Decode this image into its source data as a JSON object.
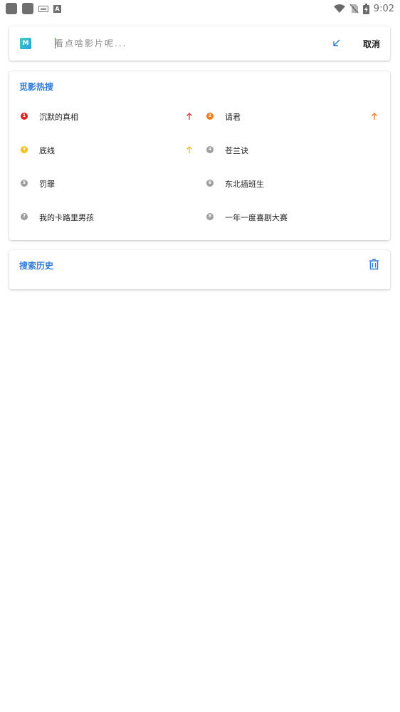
{
  "status_bar": {
    "time": "9:02",
    "left_icons": [
      "app-icon-1",
      "app-icon-2",
      "keyboard-icon",
      "font-a-icon"
    ],
    "right_icons": [
      "wifi-icon",
      "no-sim-icon",
      "battery-charging-icon"
    ]
  },
  "search": {
    "placeholder": "看点啥影片呢...",
    "value": "",
    "cancel_label": "取消",
    "logo_text": "M",
    "accent": "#2e7bd6"
  },
  "hot": {
    "title": "觅影热搜",
    "items": [
      {
        "rank": "1",
        "name": "沉默的真相",
        "trend": "up",
        "badge_color": "#e02424",
        "trend_color": "#d73a3a"
      },
      {
        "rank": "2",
        "name": "请君",
        "trend": "up",
        "badge_color": "#f07a1a",
        "trend_color": "#f07a1a"
      },
      {
        "rank": "3",
        "name": "底线",
        "trend": "up",
        "badge_color": "#f2c11b",
        "trend_color": "#f2b81b"
      },
      {
        "rank": "4",
        "name": "苍兰诀",
        "trend": "",
        "badge_color": "#9e9e9e",
        "trend_color": ""
      },
      {
        "rank": "5",
        "name": "罚罪",
        "trend": "",
        "badge_color": "#9e9e9e",
        "trend_color": ""
      },
      {
        "rank": "6",
        "name": "东北插班生",
        "trend": "",
        "badge_color": "#9e9e9e",
        "trend_color": ""
      },
      {
        "rank": "7",
        "name": "我的卡路里男孩",
        "trend": "",
        "badge_color": "#9e9e9e",
        "trend_color": ""
      },
      {
        "rank": "8",
        "name": "一年一度喜剧大赛",
        "trend": "",
        "badge_color": "#9e9e9e",
        "trend_color": ""
      }
    ]
  },
  "history": {
    "title": "搜索历史",
    "clear_icon": "trash-icon"
  }
}
